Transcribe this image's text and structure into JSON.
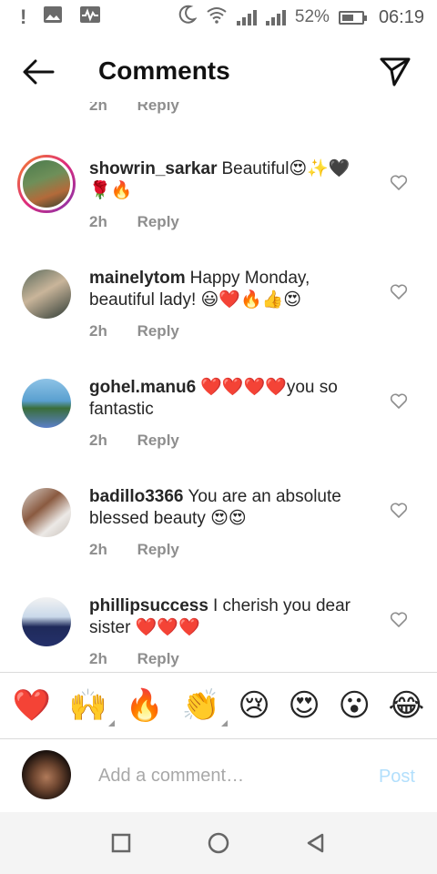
{
  "status_bar": {
    "battery": "52%",
    "time": "06:19"
  },
  "header": {
    "title": "Comments"
  },
  "partial": {
    "time": "2h",
    "reply": "Reply"
  },
  "comments": [
    {
      "user": "showrin_sarkar",
      "text": "Beautiful😍✨🖤🌹🔥",
      "time": "2h",
      "reply": "Reply"
    },
    {
      "user": "mainelytom",
      "text": "Happy Monday, beautiful lady! 😃❤️🔥👍😍",
      "time": "2h",
      "reply": "Reply"
    },
    {
      "user": "gohel.manu6",
      "text": "❤️❤️❤️❤️you so fantastic",
      "time": "2h",
      "reply": "Reply"
    },
    {
      "user": "badillo3366",
      "text": "You are an absolute blessed beauty 😍😍",
      "time": "2h",
      "reply": "Reply"
    },
    {
      "user": "phillipsuccess",
      "text": "I cherish you dear sister ❤️❤️❤️",
      "time": "2h",
      "reply": "Reply"
    }
  ],
  "emoji_bar": [
    "❤️",
    "🙌",
    "🔥",
    "👏",
    "😢",
    "😍",
    "😮",
    "😂"
  ],
  "add_comment": {
    "placeholder": "Add a comment…",
    "post": "Post"
  },
  "colors": {
    "post_disabled": "#b2dffc",
    "meta": "#8e8e8e",
    "heart_red": "#e0245e"
  },
  "icons": {
    "back": "arrow-left-icon",
    "send": "paper-plane-icon",
    "like": "heart-outline-icon",
    "nav": [
      "square-icon",
      "circle-icon",
      "triangle-back-icon"
    ]
  }
}
